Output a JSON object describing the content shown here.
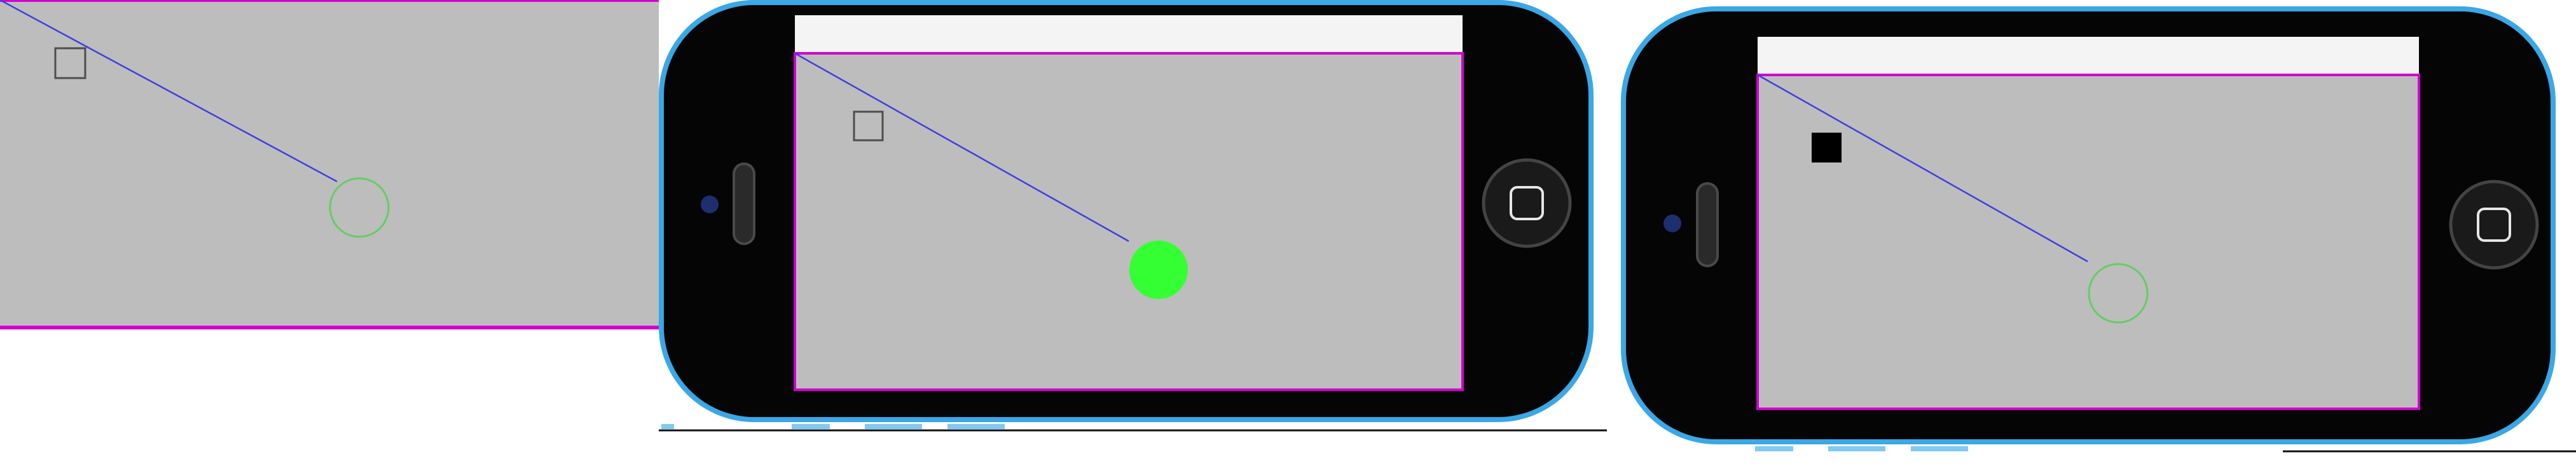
{
  "panels": [
    {
      "id": "left",
      "circle_state": "outline",
      "square_state": "outline",
      "device_frame": false
    },
    {
      "id": "middle",
      "circle_state": "filled",
      "square_state": "outline",
      "device_frame": true,
      "device_shell_color": "#3aa7e6"
    },
    {
      "id": "right",
      "circle_state": "outline",
      "square_state": "filled",
      "device_frame": true,
      "device_shell_color": "#3aa7e6"
    }
  ],
  "icons": {
    "home_button_icon": "home-button-icon",
    "camera_icon": "camera-icon",
    "speaker_icon": "speaker-icon"
  },
  "colors": {
    "canvas_background": "#bdbdbd",
    "canvas_border": "#d100d1",
    "connector_line": "#3f3fe0",
    "target_circle": "#33ff33",
    "target_circle_outline": "#66cc66",
    "device_black": "#050505",
    "status_bar": "#f4f4f4",
    "divider": "#111111"
  }
}
